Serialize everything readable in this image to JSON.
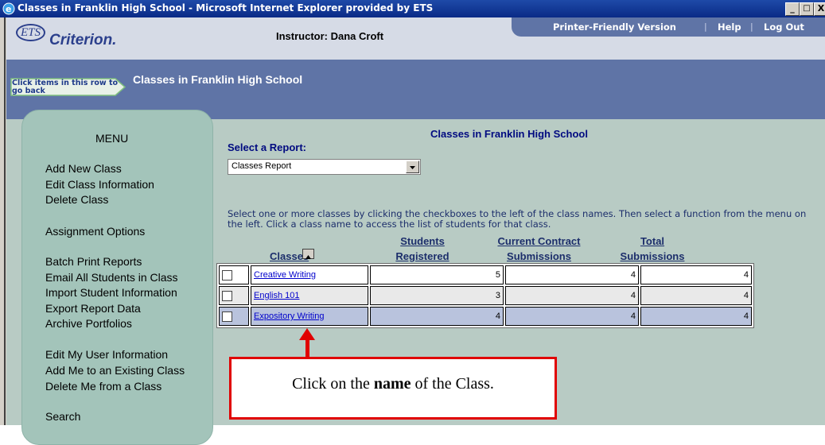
{
  "window": {
    "title": "Classes in Franklin High School - Microsoft Internet Explorer provided by ETS",
    "controls": [
      "_",
      "□",
      "X"
    ]
  },
  "header": {
    "logo_ets": "ETS",
    "logo_name": "Criterion.",
    "instructor": "Instructor: Dana Croft",
    "links": [
      "Printer-Friendly Version",
      "Help",
      "Log Out"
    ],
    "separator": "|"
  },
  "breadcrumb": {
    "back_hint": "Click items in this row to go back",
    "current": "Classes in Franklin High School"
  },
  "menu": {
    "title": "MENU",
    "items": [
      "Add New Class",
      "Edit Class Information",
      "Delete Class",
      "Assignment Options",
      "Batch Print Reports",
      "Email All Students in Class",
      "Import Student Information",
      "Export Report Data",
      "Archive Portfolios",
      "Edit My User Information",
      "Add Me to an Existing Class",
      "Delete Me from a Class",
      "Search"
    ]
  },
  "content": {
    "title": "Classes in Franklin High School",
    "select_label": "Select a Report:",
    "select_value": "Classes Report",
    "instructions": "Select one or more classes by clicking the checkboxes to the left of the class names. Then select a function from the menu on the left. Click a class name to access the list of students for that class.",
    "columns": {
      "classes": "Classes",
      "students_1": "Students",
      "students_2": "Registered",
      "contract_1": "Current Contract",
      "contract_2": "Submissions",
      "total_1": "Total",
      "total_2": "Submissions"
    },
    "rows": [
      {
        "name": "Creative Writing",
        "students": "5",
        "current": "4",
        "total": "4"
      },
      {
        "name": "English 101",
        "students": "3",
        "current": "4",
        "total": "4"
      },
      {
        "name": "Expository Writing",
        "students": "4",
        "current": "4",
        "total": "4"
      }
    ]
  },
  "callout": {
    "before": "Click on the ",
    "bold": "name",
    "after": " of the Class."
  },
  "colors": {
    "titlebar": "#0a2a86",
    "band": "#5f74a6",
    "menu_bg": "#a3c4ba",
    "main_bg": "#b8cbc4",
    "callout_border": "#e00000"
  }
}
